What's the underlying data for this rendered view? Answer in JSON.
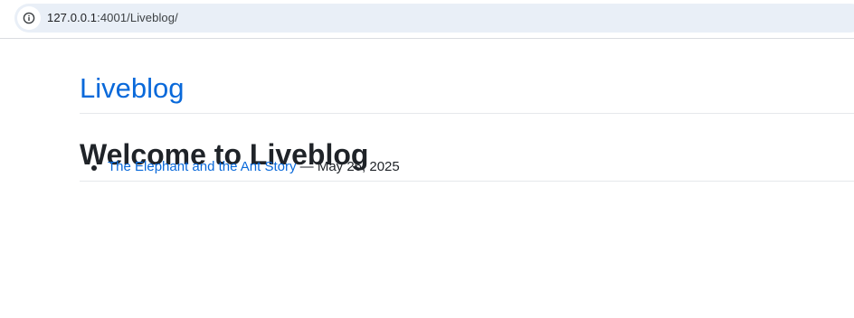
{
  "browser": {
    "url_host": "127.0.0.1",
    "url_path": ":4001/Liveblog/",
    "site_info_icon": "info-circle-icon"
  },
  "site": {
    "title": "Liveblog"
  },
  "main": {
    "heading": "Welcome to Liveblog",
    "posts": [
      {
        "title": "The Elephant and the Ant Story",
        "separator": " — ",
        "date": "May 26, 2025"
      }
    ]
  },
  "colors": {
    "link": "#0969da",
    "text": "#1f2328",
    "address_bar": "#e9eff7"
  }
}
